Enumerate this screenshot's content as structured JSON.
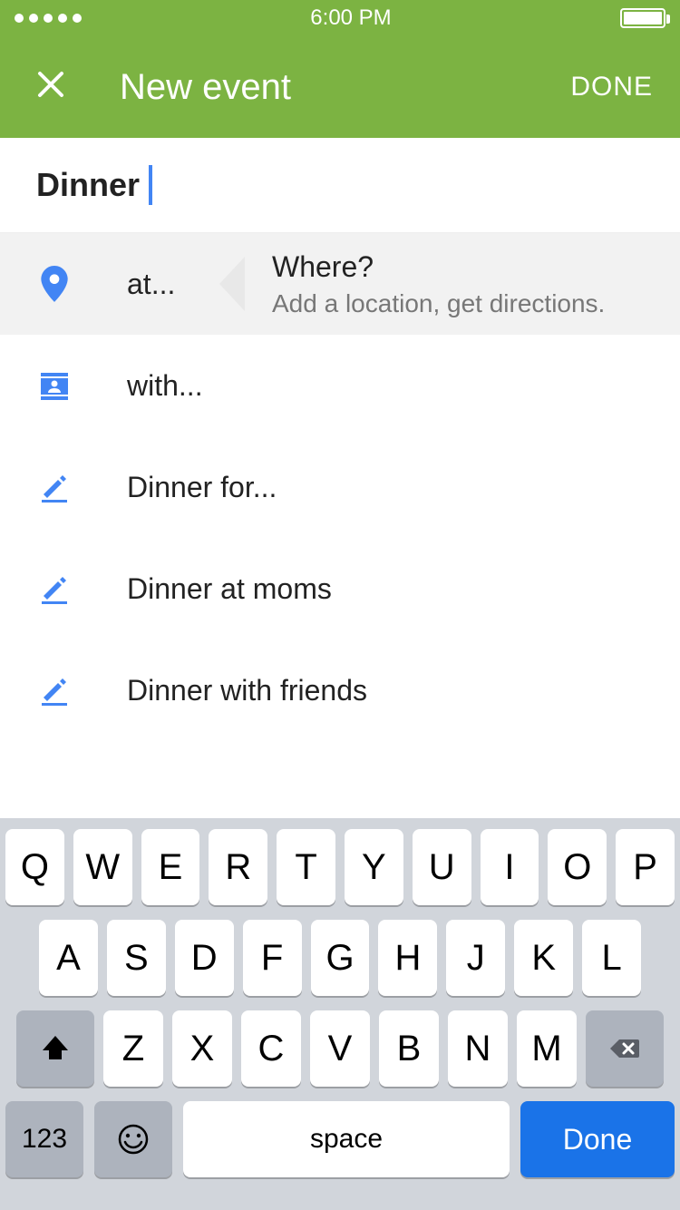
{
  "status": {
    "time": "6:00 PM"
  },
  "header": {
    "title": "New event",
    "done": "DONE"
  },
  "input": {
    "value": "Dinner"
  },
  "rows": {
    "at": {
      "label": "at...",
      "hint_title": "Where?",
      "hint_sub": "Add a location, get directions."
    },
    "with": {
      "label": "with..."
    },
    "s1": {
      "label": "Dinner for..."
    },
    "s2": {
      "label": "Dinner at moms"
    },
    "s3": {
      "label": "Dinner with friends"
    }
  },
  "keyboard": {
    "row1": [
      "Q",
      "W",
      "E",
      "R",
      "T",
      "Y",
      "U",
      "I",
      "O",
      "P"
    ],
    "row2": [
      "A",
      "S",
      "D",
      "F",
      "G",
      "H",
      "J",
      "K",
      "L"
    ],
    "row3": [
      "Z",
      "X",
      "C",
      "V",
      "B",
      "N",
      "M"
    ],
    "num": "123",
    "space": "space",
    "done": "Done"
  }
}
